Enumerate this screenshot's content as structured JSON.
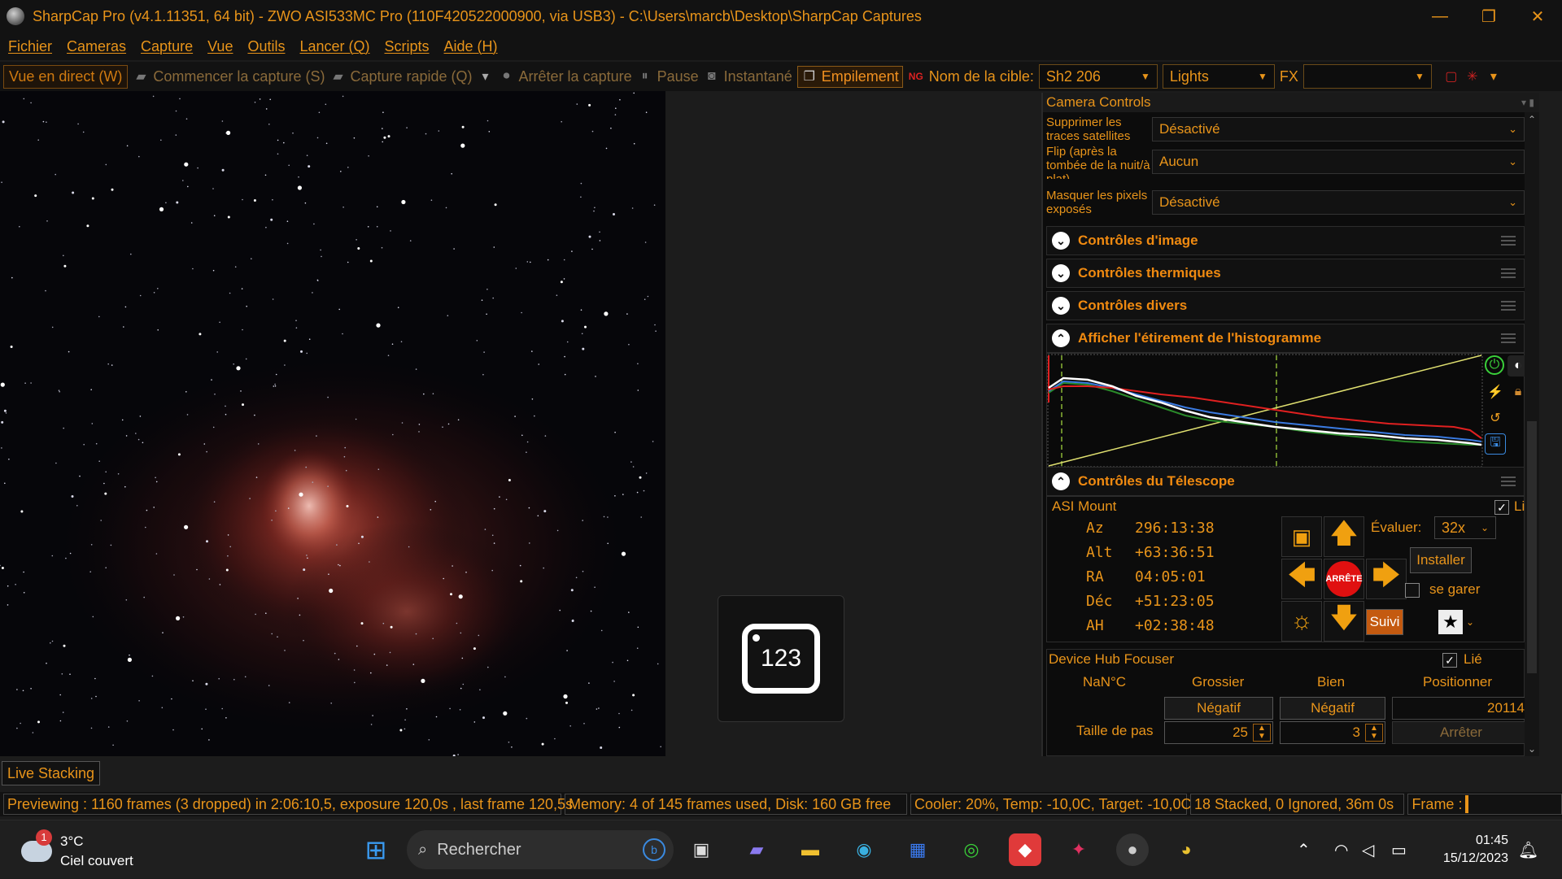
{
  "window": {
    "title": "SharpCap Pro (v4.1.11351, 64 bit) - ZWO ASI533MC Pro (110F420522000900, via USB3) - C:\\Users\\marcb\\Desktop\\SharpCap Captures",
    "minimize": "—",
    "maximize": "❐",
    "close": "✕"
  },
  "menu": [
    "Fichier",
    "Cameras",
    "Capture",
    "Vue",
    "Outils",
    "Lancer (Q)",
    "Scripts",
    "Aide (H)"
  ],
  "toolbar": {
    "live_view": "Vue en direct (W)",
    "start_capture": "Commencer la capture (S)",
    "quick_capture": "Capture rapide (Q)",
    "stop_capture": "Arrêter la capture",
    "pause": "Pause",
    "snapshot": "Instantané",
    "stacking": "Empilement",
    "target_label": "Nom de la cible:",
    "target_value": "Sh2 206",
    "frame_type": "Lights",
    "fx_label": "FX",
    "fx_value": ""
  },
  "overlay": {
    "keypad_text": "123"
  },
  "panel": {
    "title": "Camera Controls",
    "controls": [
      {
        "label": "Supprimer les traces satellites",
        "value": "Désactivé"
      },
      {
        "label": "Flip (après la tombée de la nuit/à plat)",
        "value": "Aucun"
      },
      {
        "label": "Masquer les pixels exposés",
        "value": "Désactivé"
      }
    ],
    "sections": {
      "image": "Contrôles d'image",
      "thermal": "Contrôles thermiques",
      "misc": "Contrôles divers",
      "histogram": "Afficher l'étirement de l'histogramme",
      "telescope": "Contrôles du Télescope"
    },
    "telescope": {
      "mount": "ASI Mount",
      "linked_label": "Lié",
      "coords": [
        {
          "label": "Az",
          "value": "296:13:38"
        },
        {
          "label": "Alt",
          "value": "+63:36:51"
        },
        {
          "label": "RA",
          "value": "04:05:01"
        },
        {
          "label": "Déc",
          "value": "+51:23:05"
        },
        {
          "label": "AH",
          "value": "+02:38:48"
        }
      ],
      "stop_label": "ARRÊTE",
      "rate_label": "Évaluer:",
      "rate_value": "32x",
      "setup_button": "Installer",
      "park_label": "se garer",
      "tracking_button": "Suivi"
    },
    "focuser": {
      "name": "Device Hub Focuser",
      "linked_label": "Lié",
      "temp": "NaN°C",
      "coarse_label": "Grossier",
      "fine_label": "Bien",
      "position_label": "Positionner",
      "coarse_neg": "Négatif",
      "fine_neg": "Négatif",
      "position_value": "20114",
      "step_label": "Taille de pas",
      "coarse_step": "25",
      "fine_step": "3",
      "stop_button": "Arrêter"
    }
  },
  "live_tab": "Live Stacking",
  "status": {
    "preview": "Previewing : 1160 frames (3 dropped) in 2:06:10,5, exposure 120,0s , last frame 120,5s",
    "memory": "Memory: 4 of 145 frames used, Disk: 160 GB free",
    "cooler": "Cooler: 20%, Temp: -10,0C, Target: -10,0C",
    "stack": "18 Stacked, 0 Ignored, 36m 0s",
    "frame": "Frame :"
  },
  "taskbar": {
    "weather_badge": "1",
    "temperature": "3°C",
    "weather_desc": "Ciel couvert",
    "search_placeholder": "Rechercher",
    "time": "01:45",
    "date": "15/12/2023"
  }
}
